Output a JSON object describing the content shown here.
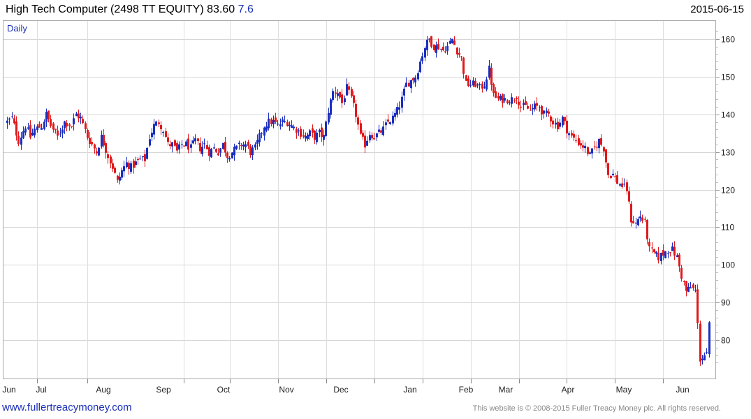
{
  "header": {
    "title": "High Tech Computer (2498 TT EQUITY) 83.60",
    "change": "7.6",
    "date": "2015-06-15"
  },
  "footer": {
    "link": "www.fullertreacymoney.com",
    "copyright": "This website is © 2008-2015 Fuller Treacy Money plc. All rights reserved."
  },
  "colors": {
    "up": "#1a2fbf",
    "down": "#e0191b",
    "grid": "#d6d6d6",
    "frame": "#aaaaaa",
    "text_accent": "#1b2fb8"
  },
  "chart_data": {
    "type": "candlestick",
    "period": "Daily",
    "y_ticks": [
      80,
      90,
      100,
      110,
      120,
      130,
      140,
      150,
      160
    ],
    "ylim": [
      72,
      163
    ],
    "x_tick_labels": [
      "Jun",
      "Jul",
      "Aug",
      "Sep",
      "Oct",
      "Nov",
      "Dec",
      "Jan",
      "Feb",
      "Mar",
      "Apr",
      "May",
      "Jun"
    ],
    "grid": true,
    "close_path": [
      [
        0,
        138
      ],
      [
        2,
        139
      ],
      [
        5,
        133
      ],
      [
        8,
        137
      ],
      [
        10,
        134
      ],
      [
        12,
        136
      ],
      [
        15,
        137
      ],
      [
        17,
        140
      ],
      [
        19,
        137
      ],
      [
        22,
        134
      ],
      [
        25,
        138
      ],
      [
        28,
        137
      ],
      [
        30,
        140
      ],
      [
        32,
        139
      ],
      [
        35,
        134
      ],
      [
        37,
        132
      ],
      [
        39,
        130
      ],
      [
        41,
        134
      ],
      [
        44,
        129
      ],
      [
        46,
        126
      ],
      [
        48,
        122
      ],
      [
        50,
        125
      ],
      [
        52,
        127
      ],
      [
        54,
        126
      ],
      [
        56,
        127
      ],
      [
        58,
        128
      ],
      [
        60,
        128
      ],
      [
        62,
        134
      ],
      [
        64,
        137
      ],
      [
        66,
        138
      ],
      [
        68,
        136
      ],
      [
        70,
        132
      ],
      [
        72,
        132
      ],
      [
        74,
        130
      ],
      [
        76,
        132
      ],
      [
        78,
        132
      ],
      [
        80,
        131
      ],
      [
        82,
        133
      ],
      [
        84,
        131
      ],
      [
        86,
        132
      ],
      [
        88,
        130
      ],
      [
        90,
        131
      ],
      [
        92,
        130
      ],
      [
        94,
        132
      ],
      [
        96,
        129
      ],
      [
        98,
        130
      ],
      [
        100,
        131
      ],
      [
        102,
        132
      ],
      [
        104,
        132
      ],
      [
        106,
        130
      ],
      [
        108,
        131
      ],
      [
        110,
        134
      ],
      [
        112,
        137
      ],
      [
        114,
        138
      ],
      [
        116,
        138
      ],
      [
        118,
        137
      ],
      [
        120,
        138
      ],
      [
        122,
        138
      ],
      [
        124,
        137
      ],
      [
        126,
        136
      ],
      [
        128,
        135
      ],
      [
        130,
        134
      ],
      [
        132,
        135
      ],
      [
        134,
        134
      ],
      [
        136,
        135
      ],
      [
        138,
        134
      ],
      [
        140,
        141
      ],
      [
        142,
        146
      ],
      [
        144,
        146
      ],
      [
        146,
        143
      ],
      [
        148,
        147
      ],
      [
        150,
        144
      ],
      [
        152,
        140
      ],
      [
        154,
        134
      ],
      [
        156,
        132
      ],
      [
        158,
        135
      ],
      [
        160,
        134
      ],
      [
        162,
        135
      ],
      [
        164,
        136
      ],
      [
        166,
        138
      ],
      [
        168,
        139
      ],
      [
        170,
        141
      ],
      [
        172,
        144
      ],
      [
        174,
        148
      ],
      [
        176,
        149
      ],
      [
        178,
        150
      ],
      [
        180,
        154
      ],
      [
        182,
        158
      ],
      [
        184,
        160
      ],
      [
        186,
        158
      ],
      [
        188,
        158
      ],
      [
        190,
        157
      ],
      [
        192,
        158
      ],
      [
        194,
        160
      ],
      [
        196,
        157
      ],
      [
        198,
        155
      ],
      [
        200,
        148
      ],
      [
        202,
        148
      ],
      [
        204,
        148
      ],
      [
        206,
        147
      ],
      [
        208,
        148
      ],
      [
        210,
        152
      ],
      [
        212,
        145
      ],
      [
        214,
        144
      ],
      [
        216,
        144
      ],
      [
        218,
        144
      ],
      [
        220,
        144
      ],
      [
        222,
        145
      ],
      [
        224,
        142
      ],
      [
        226,
        142
      ],
      [
        228,
        141
      ],
      [
        230,
        142
      ],
      [
        232,
        142
      ],
      [
        234,
        140
      ],
      [
        236,
        140
      ],
      [
        238,
        138
      ],
      [
        240,
        137
      ],
      [
        242,
        139
      ],
      [
        244,
        136
      ],
      [
        246,
        134
      ],
      [
        248,
        133
      ],
      [
        250,
        132
      ],
      [
        252,
        131
      ],
      [
        254,
        129
      ],
      [
        256,
        131
      ],
      [
        258,
        133
      ],
      [
        260,
        131
      ],
      [
        262,
        124
      ],
      [
        264,
        124
      ],
      [
        266,
        122
      ],
      [
        268,
        121
      ],
      [
        270,
        120
      ],
      [
        272,
        112
      ],
      [
        274,
        111
      ],
      [
        276,
        113
      ],
      [
        278,
        111
      ],
      [
        280,
        104
      ],
      [
        282,
        103
      ],
      [
        284,
        102
      ],
      [
        286,
        103
      ],
      [
        288,
        104
      ],
      [
        290,
        104
      ],
      [
        292,
        102
      ],
      [
        294,
        97
      ],
      [
        296,
        93
      ],
      [
        298,
        94
      ],
      [
        300,
        93
      ],
      [
        302,
        75
      ],
      [
        304,
        76
      ],
      [
        305,
        76
      ],
      [
        306,
        84
      ]
    ]
  }
}
